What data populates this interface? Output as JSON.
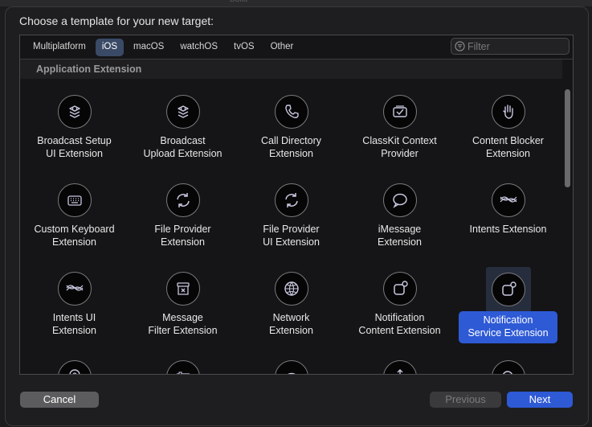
{
  "dialog": {
    "heading": "Choose a template for your new target:"
  },
  "tabs": [
    {
      "label": "Multiplatform"
    },
    {
      "label": "iOS",
      "active": true
    },
    {
      "label": "macOS"
    },
    {
      "label": "watchOS"
    },
    {
      "label": "tvOS"
    },
    {
      "label": "Other"
    }
  ],
  "filter": {
    "placeholder": "Filter",
    "value": ""
  },
  "section": {
    "title": "Application Extension"
  },
  "templates": [
    {
      "label": "Broadcast Setup\nUI Extension",
      "icon": "broadcast-icon"
    },
    {
      "label": "Broadcast\nUpload Extension",
      "icon": "broadcast-icon"
    },
    {
      "label": "Call Directory\nExtension",
      "icon": "phone-icon"
    },
    {
      "label": "ClassKit Context\nProvider",
      "icon": "classkit-icon"
    },
    {
      "label": "Content Blocker\nExtension",
      "icon": "hand-icon"
    },
    {
      "label": "Custom Keyboard\nExtension",
      "icon": "keyboard-icon"
    },
    {
      "label": "File Provider\nExtension",
      "icon": "sync-icon"
    },
    {
      "label": "File Provider\nUI Extension",
      "icon": "sync-icon"
    },
    {
      "label": "iMessage\nExtension",
      "icon": "message-bubble-icon"
    },
    {
      "label": "Intents Extension",
      "icon": "intents-wave-icon"
    },
    {
      "label": "Intents UI\nExtension",
      "icon": "intents-wave-icon"
    },
    {
      "label": "Message\nFilter Extension",
      "icon": "message-filter-icon"
    },
    {
      "label": "Network\nExtension",
      "icon": "globe-icon"
    },
    {
      "label": "Notification\nContent Extension",
      "icon": "notification-icon"
    },
    {
      "label": "Notification\nService Extension",
      "icon": "notification-icon",
      "selected": true
    },
    {
      "label": "",
      "icon": "location-pin-icon"
    },
    {
      "label": "",
      "icon": "sliders-icon"
    },
    {
      "label": "",
      "icon": "eye-icon"
    },
    {
      "label": "",
      "icon": "share-icon"
    },
    {
      "label": "",
      "icon": "search-icon"
    }
  ],
  "buttons": {
    "cancel": "Cancel",
    "previous": "Previous",
    "next": "Next"
  },
  "colors": {
    "accent": "#2e5ad6",
    "tabActive": "#3a4a66",
    "background": "#1e1e20"
  }
}
